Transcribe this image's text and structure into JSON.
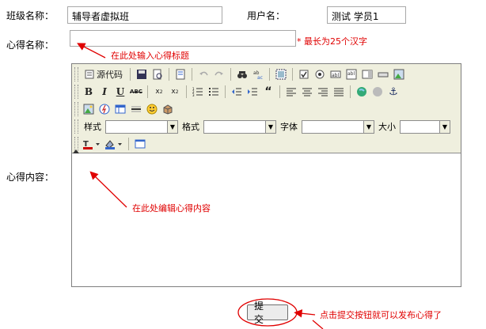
{
  "form": {
    "class_label": "班级名称：",
    "class_value": "辅导者虚拟班",
    "user_label": "用户名：",
    "user_value": "测试 学员1",
    "title_label": "心得名称：",
    "title_value": "",
    "title_hint": "* 最长为25个汉字",
    "content_label": "心得内容："
  },
  "annotations": {
    "title_note": "在此处输入心得标题",
    "content_note": "在此处编辑心得内容",
    "submit_note": "点击提交按钮就可以发布心得了",
    "color": "#e00000"
  },
  "editor": {
    "source_label": "源代码",
    "style_label": "样式",
    "format_label": "格式",
    "font_label": "字体",
    "size_label": "大小",
    "style_value": "",
    "format_value": "",
    "font_value": "",
    "size_value": ""
  },
  "submit_label": "提 交"
}
